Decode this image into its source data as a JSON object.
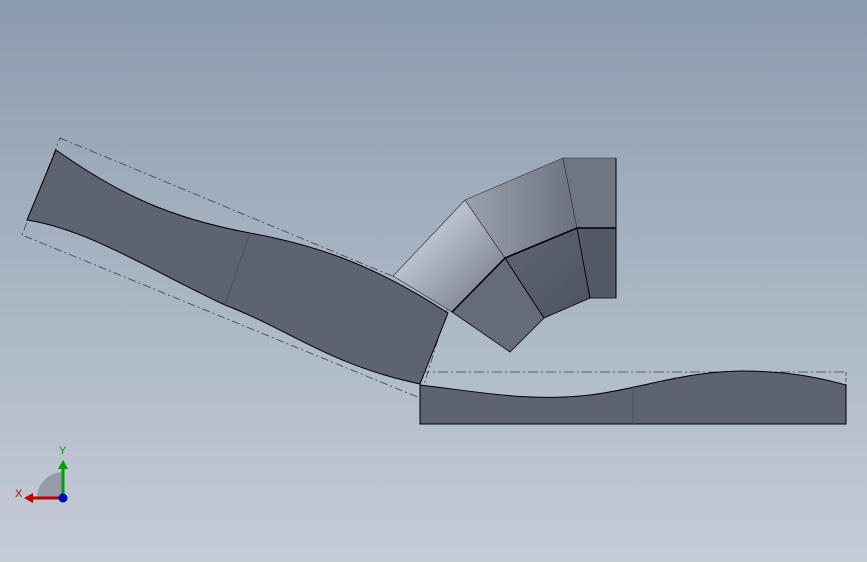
{
  "triad": {
    "x_label": "X",
    "y_label": "Y",
    "x_color": "#c00000",
    "y_color": "#00a000",
    "z_color": "#0000c0"
  },
  "colors": {
    "background_top": "#8b9bae",
    "background_bottom": "#c4ccd6",
    "part_face": "#5d6370",
    "edge": "#000000",
    "construction_line": "#3c4048"
  },
  "scene": {
    "bodies": [
      "curved-plate-left",
      "elbow-duct",
      "flat-plate-right"
    ]
  }
}
